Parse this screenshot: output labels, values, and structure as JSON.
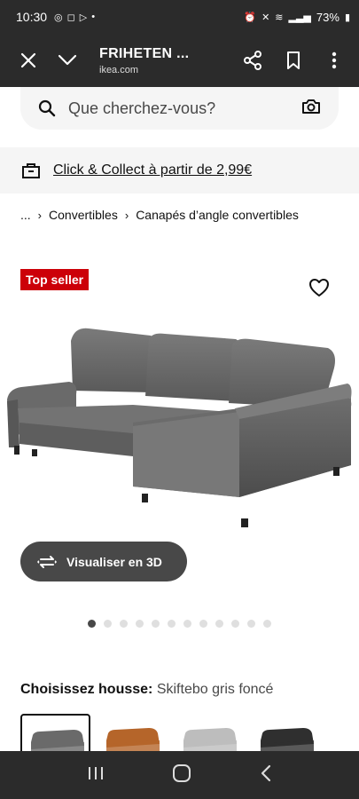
{
  "status": {
    "time": "10:30",
    "battery": "73%"
  },
  "header": {
    "title": "FRIHETEN ...",
    "url": "ikea.com"
  },
  "search": {
    "placeholder": "Que cherchez-vous?"
  },
  "promo": {
    "label": "Click & Collect à partir de 2,99€"
  },
  "breadcrumb": {
    "ellipsis": "...",
    "sep": "›",
    "items": [
      "Convertibles",
      "Canapés d’angle convertibles"
    ]
  },
  "product": {
    "badge": "Top seller",
    "view3d_label": "Visualiser en 3D",
    "gallery_count": 12,
    "gallery_active": 0,
    "cover_label": "Choisissez housse:",
    "cover_value": "Skiftebo gris foncé",
    "cover_swatches": [
      "#6a6a6a",
      "#b5652a",
      "#bdbdbd",
      "#2f2f2f"
    ]
  },
  "colors": {
    "bar": "#2b2b2b",
    "badge": "#cc0008",
    "pill": "#484848"
  }
}
